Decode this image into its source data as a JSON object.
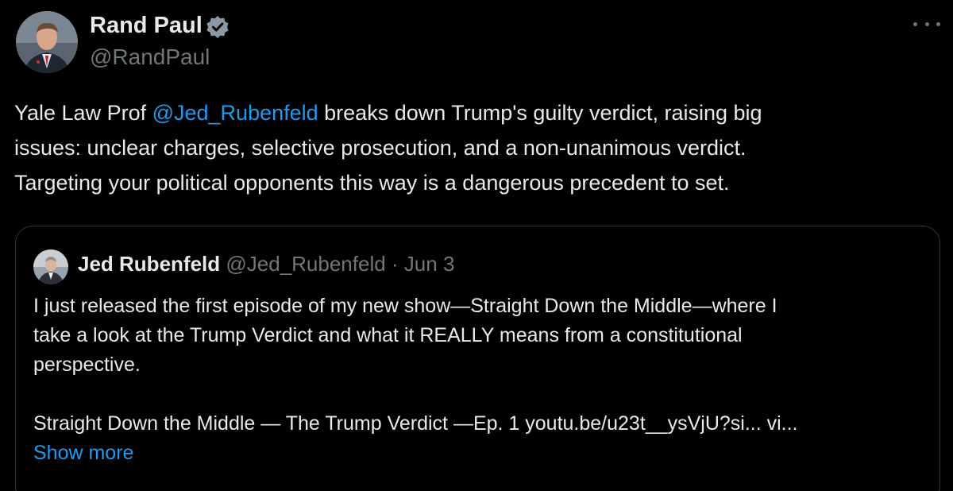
{
  "tweet": {
    "author": {
      "name": "Rand Paul",
      "handle": "@RandPaul",
      "verified": true
    },
    "body": {
      "line1_before": "Yale Law Prof ",
      "line1_mention": "@Jed_Rubenfeld",
      "line1_after": " breaks down Trump's guilty verdict, raising big",
      "line2": "issues: unclear charges, selective prosecution, and a non-unanimous verdict.",
      "line3": "Targeting your political opponents this way is a dangerous precedent to set."
    },
    "quoted": {
      "name": "Jed Rubenfeld",
      "handle": "@Jed_Rubenfeld",
      "separator": " · ",
      "date": "Jun 3",
      "lines": [
        "I just released the first episode of my new show—Straight Down the Middle—where I",
        "take a look at the Trump Verdict and what it REALLY means from a constitutional",
        "perspective.",
        "",
        "Straight Down the Middle — The Trump Verdict —Ep. 1 youtu.be/u23t__ysVjU?si... vi..."
      ],
      "show_more": "Show more"
    }
  },
  "colors": {
    "background": "#000000",
    "text": "#e7e9ea",
    "secondary": "#71767b",
    "link": "#1d9bf0",
    "border": "#333639"
  },
  "icons": {
    "verified": "verified-badge-icon",
    "more": "more-horizontal-icon"
  }
}
